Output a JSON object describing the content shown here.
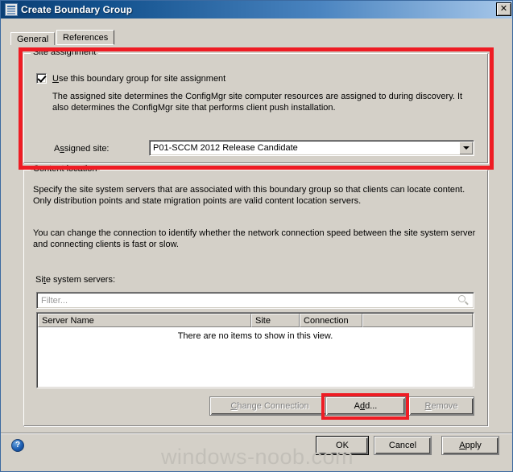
{
  "window": {
    "title": "Create Boundary Group",
    "icon": "window-icon",
    "close_label": "✕"
  },
  "tabs": [
    {
      "label": "General",
      "active": false
    },
    {
      "label": "References",
      "active": true
    }
  ],
  "site_assignment": {
    "caption": "Site assignment",
    "checkbox": {
      "label": "Use this boundary group for site assignment",
      "checked": true
    },
    "description": "The assigned site determines the ConfigMgr site computer resources are assigned to during discovery. It also determines the ConfigMgr site that performs client push installation.",
    "assigned_site_label": "Assigned site:",
    "assigned_site_value": "P01-SCCM 2012 Release Candidate"
  },
  "content_location": {
    "caption": "Content location",
    "description_1": "Specify the site system servers that are associated with this boundary group so that clients can locate content. Only distribution points and state migration points are valid content location servers.",
    "description_2": "You can change the connection to identify whether the network connection speed between the site system server and connecting clients is fast or slow.",
    "servers_label": "Site system servers:",
    "filter_placeholder": "Filter...",
    "search_icon": "magnifier-icon",
    "columns": [
      "Server Name",
      "Site",
      "Connection",
      ""
    ],
    "rows": [],
    "empty_message": "There are no items to show in this view.",
    "buttons": {
      "change_connection": "Change Connection",
      "add": "Add...",
      "remove": "Remove"
    }
  },
  "footer": {
    "help_icon": "?",
    "ok": "OK",
    "cancel": "Cancel",
    "apply": "Apply"
  },
  "watermark": "windows-noob.com",
  "colors": {
    "dialog_face": "#d4d0c8",
    "title_start": "#0b3f75",
    "title_end": "#a8c8ea",
    "annotation_red": "#ee1c24",
    "watermark_gray": "#c2bfb8"
  }
}
